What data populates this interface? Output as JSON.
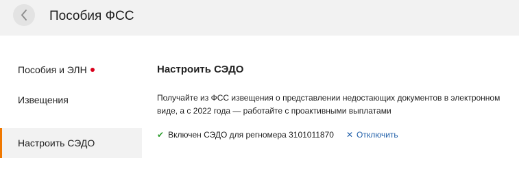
{
  "header": {
    "title": "Пособия ФСС",
    "back_icon": "chevron-left-icon"
  },
  "sidebar": {
    "items": [
      {
        "label": "Пособия и ЭЛН",
        "badge_color": "#d9001b"
      },
      {
        "label": "Извещения"
      },
      {
        "label": "Настроить СЭДО",
        "active": true
      }
    ],
    "active_color": "#f07800"
  },
  "main": {
    "title": "Настроить СЭДО",
    "description": "Получайте из ФСС извещения о представлении недостающих документов в электронном виде, а с 2022 года — работайте с проактивными выплатами",
    "status": {
      "icon": "check-icon",
      "text": "Включен СЭДО для регномера 3101011870",
      "link_icon": "x-icon",
      "link_label": "Отключить"
    }
  }
}
